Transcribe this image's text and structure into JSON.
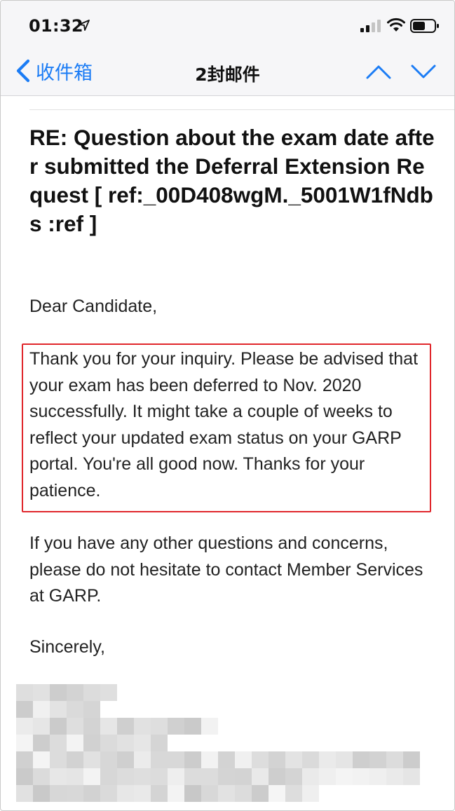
{
  "status_bar": {
    "time": "01:32"
  },
  "nav": {
    "back_label": "收件箱",
    "title": "2封邮件"
  },
  "mail": {
    "subject": "RE:  Question about the exam date after submitted the Deferral Extension Request [ ref:_00D408wgM._5001W1fNdbs :ref ]",
    "salutation": "Dear Candidate,",
    "paragraph_1": "Thank you for your inquiry. Please be advised that your exam has been deferred to Nov. 2020 successfully. It might take a couple of weeks to reflect your updated exam status on your GARP portal. You're all good now. Thanks for your patience.",
    "paragraph_2": "If you have any other questions and concerns, please do not hesitate to contact Member Services at GARP.",
    "closing": "Sincerely,"
  },
  "colors": {
    "accent": "#1b7cf5",
    "highlight_border": "#e0262b"
  }
}
